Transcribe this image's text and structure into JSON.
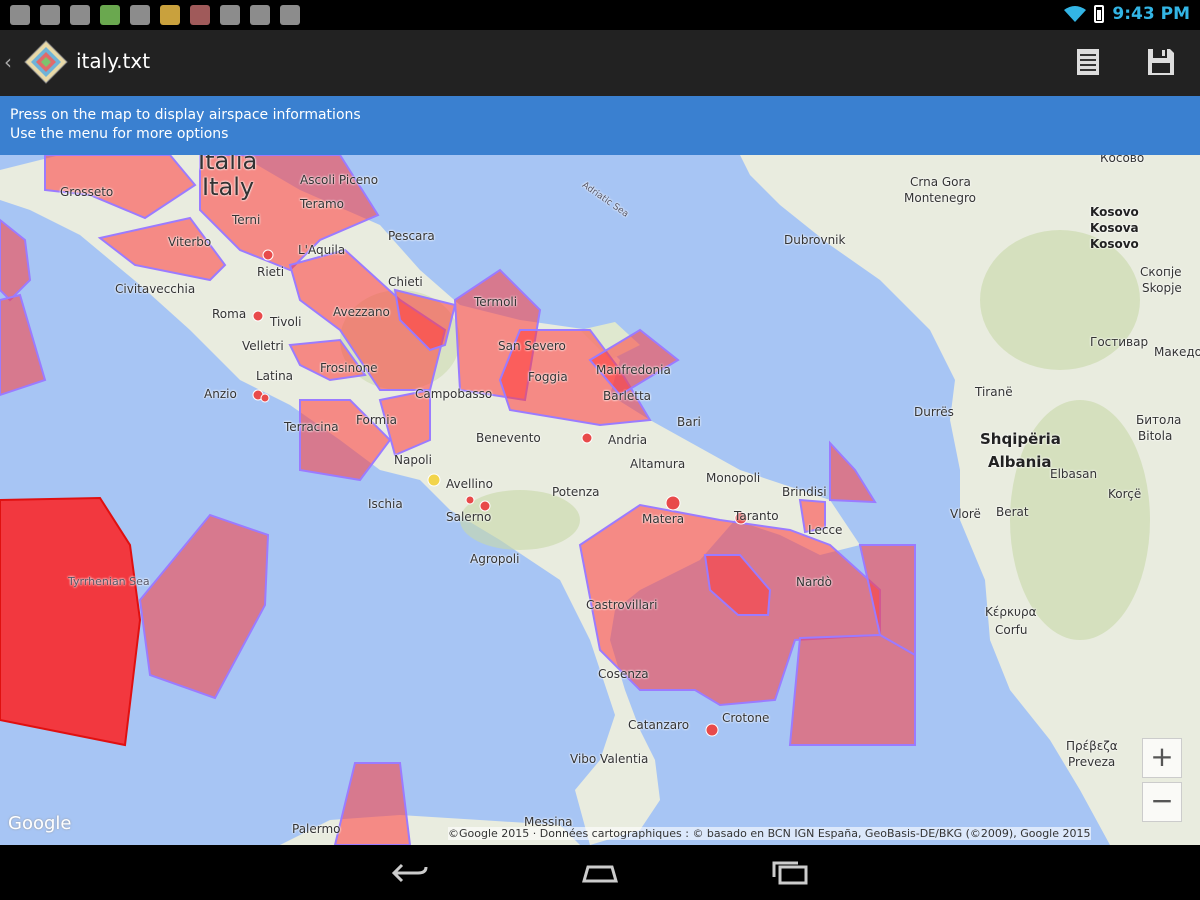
{
  "status_bar": {
    "time": "9:43 PM",
    "notification_icons": [
      "settings-icon",
      "image-icon",
      "apps-icon",
      "app-icon",
      "shield-icon",
      "app-icon",
      "app-icon",
      "gamepad-icon",
      "briefcase-icon",
      "android-icon"
    ]
  },
  "action_bar": {
    "title": "italy.txt"
  },
  "banner": {
    "line1": "Press on the map to display airspace informations",
    "line2": "Use the menu for more options"
  },
  "map": {
    "labels": {
      "italia": "Italia",
      "italy": "Italy",
      "grosseto": "Grosseto",
      "ascoli": "Ascoli Piceno",
      "teramo": "Teramo",
      "terni": "Terni",
      "viterbo": "Viterbo",
      "rieti": "Rieti",
      "laquila": "L'Aquila",
      "pescara": "Pescara",
      "chieti": "Chieti",
      "civitavecchia": "Civitavecchia",
      "roma": "Roma",
      "tivoli": "Tivoli",
      "avezzano": "Avezzano",
      "termoli": "Termoli",
      "velletri": "Velletri",
      "latina": "Latina",
      "frosinone": "Frosinone",
      "sansevero": "San Severo",
      "foggia": "Foggia",
      "manfredonia": "Manfredonia",
      "barletta": "Barletta",
      "anzio": "Anzio",
      "campobasso": "Campobasso",
      "bari": "Bari",
      "terracina": "Terracina",
      "formia": "Formia",
      "benevento": "Benevento",
      "andria": "Andria",
      "napoli": "Napoli",
      "altamura": "Altamura",
      "avellino": "Avellino",
      "monopoli": "Monopoli",
      "ischia": "Ischia",
      "salerno": "Salerno",
      "potenza": "Potenza",
      "brindisi": "Brindisi",
      "matera": "Matera",
      "taranto": "Taranto",
      "lecce": "Lecce",
      "agropoli": "Agropoli",
      "nardo": "Nardò",
      "castrovillari": "Castrovillari",
      "cosenza": "Cosenza",
      "crotone": "Crotone",
      "catanzaro": "Catanzaro",
      "vibo": "Vibo Valentia",
      "messina": "Messina",
      "palermo": "Palermo",
      "tyrrhenian": "Tyrrhenian Sea",
      "adriatic": "Adriatic Sea",
      "dubrovnik": "Dubrovnik",
      "crna_gora": "Crna Gora",
      "montenegro": "Montenegro",
      "kosovo1": "Kosovo",
      "kosovo2": "Kosova",
      "kosovo3": "Kosovo",
      "kosovo_top": "Косово",
      "skopje_cyr": "Скопје",
      "skopje": "Skopje",
      "tirane": "Tiranë",
      "durres": "Durrës",
      "shqiperia": "Shqipëria",
      "albania": "Albania",
      "bitola_cyr": "Битола",
      "bitola": "Bitola",
      "makedonija": "Македонија",
      "gostivar": "Гостивар",
      "elbasan": "Elbasan",
      "korce": "Korçë",
      "vlore": "Vlorë",
      "berat": "Berat",
      "kerkyra_gr": "Κέρκυρα",
      "corfu": "Corfu",
      "preveza_gr": "Πρέβεζα",
      "preveza": "Preveza"
    },
    "zoom_in": "+",
    "zoom_out": "−",
    "google_logo": "Google",
    "attribution": "©Google 2015 · Données cartographiques : © basado en BCN IGN España, GeoBasis-DE/BKG (©2009), Google 2015"
  },
  "colors": {
    "airspace_fill": "#ff3b3b",
    "airspace_stroke": "#9b7bff",
    "sea": "#a7c5f4",
    "land": "#e9ecdf",
    "banner": "#3a80d0",
    "clock": "#33b5e5"
  }
}
